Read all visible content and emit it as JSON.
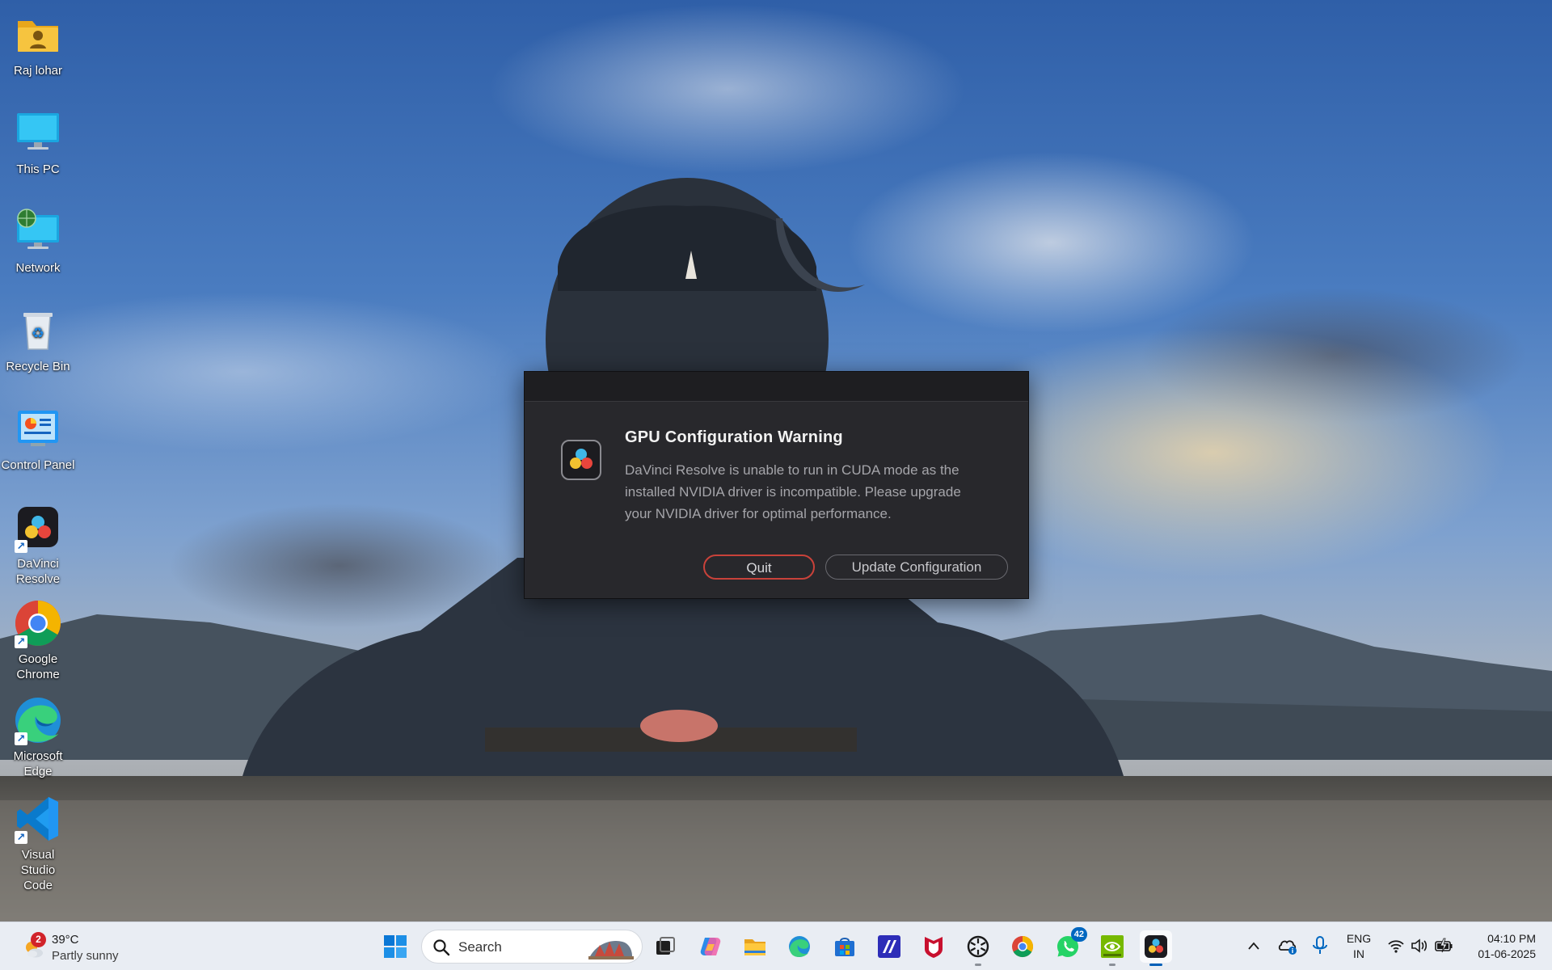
{
  "desktop": {
    "icons": [
      {
        "label": "Raj lohar",
        "icon": "user-folder-icon"
      },
      {
        "label": "This PC",
        "icon": "monitor-icon"
      },
      {
        "label": "Network",
        "icon": "network-icon"
      },
      {
        "label": "Recycle Bin",
        "icon": "recycle-bin-icon"
      },
      {
        "label": "Control Panel",
        "icon": "control-panel-icon"
      },
      {
        "label": "DaVinci Resolve",
        "icon": "davinci-resolve-icon"
      },
      {
        "label": "Google Chrome",
        "icon": "chrome-icon"
      },
      {
        "label": "Microsoft Edge",
        "icon": "edge-icon"
      },
      {
        "label": "Visual Studio Code",
        "icon": "vscode-icon"
      }
    ]
  },
  "dialog": {
    "title": "GPU Configuration Warning",
    "message": "DaVinci Resolve is unable to run in CUDA mode as the installed NVIDIA driver is incompatible. Please upgrade your NVIDIA driver for optimal performance.",
    "quit_label": "Quit",
    "update_label": "Update Configuration",
    "colors": {
      "background": "#28282c",
      "quit_border": "#c9423a"
    }
  },
  "taskbar": {
    "weather": {
      "temp": "39°C",
      "desc": "Partly sunny",
      "badge": "2"
    },
    "search_placeholder": "Search",
    "apps": [
      "start-icon",
      "task-view-icon",
      "copilot-icon",
      "file-explorer-icon",
      "edge-icon",
      "microsoft-store-icon",
      "visual-studio-icon",
      "mcafee-icon",
      "chatgpt-icon",
      "chrome-icon",
      "whatsapp-icon",
      "nvidia-icon",
      "davinci-resolve-icon"
    ],
    "whatsapp_badge": "42",
    "tray": {
      "lang_line1": "ENG",
      "lang_line2": "IN",
      "time": "04:10 PM",
      "date": "01-06-2025"
    }
  }
}
